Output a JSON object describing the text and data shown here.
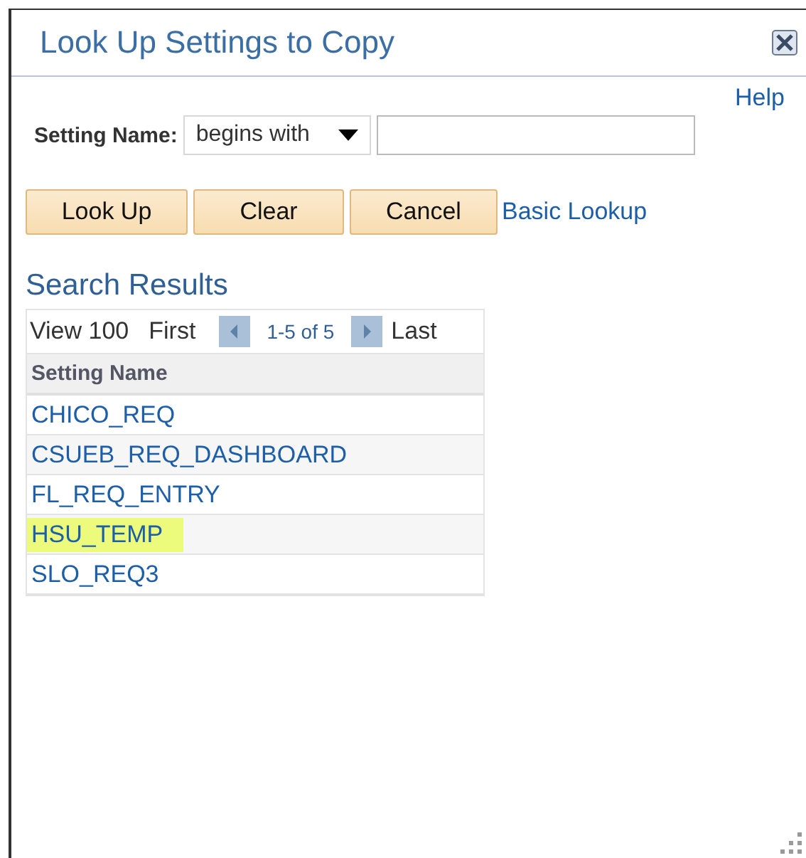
{
  "window": {
    "title": "Look Up Settings to Copy"
  },
  "help_link": "Help",
  "search": {
    "label": "Setting Name:",
    "operator": "begins with"
  },
  "buttons": [
    "Look Up",
    "Clear",
    "Cancel"
  ],
  "basic_lookup_link": "Basic Lookup",
  "results": {
    "title": "Search Results",
    "view": "View 100",
    "first": "First",
    "range": "1-5 of 5",
    "last": "Last",
    "column": "Setting Name",
    "rows": [
      {
        "name": "CHICO_REQ",
        "highlighted": false
      },
      {
        "name": "CSUEB_REQ_DASHBOARD",
        "highlighted": false
      },
      {
        "name": "FL_REQ_ENTRY",
        "highlighted": false
      },
      {
        "name": "HSU_TEMP",
        "highlighted": true
      },
      {
        "name": "SLO_REQ3",
        "highlighted": false
      }
    ]
  }
}
